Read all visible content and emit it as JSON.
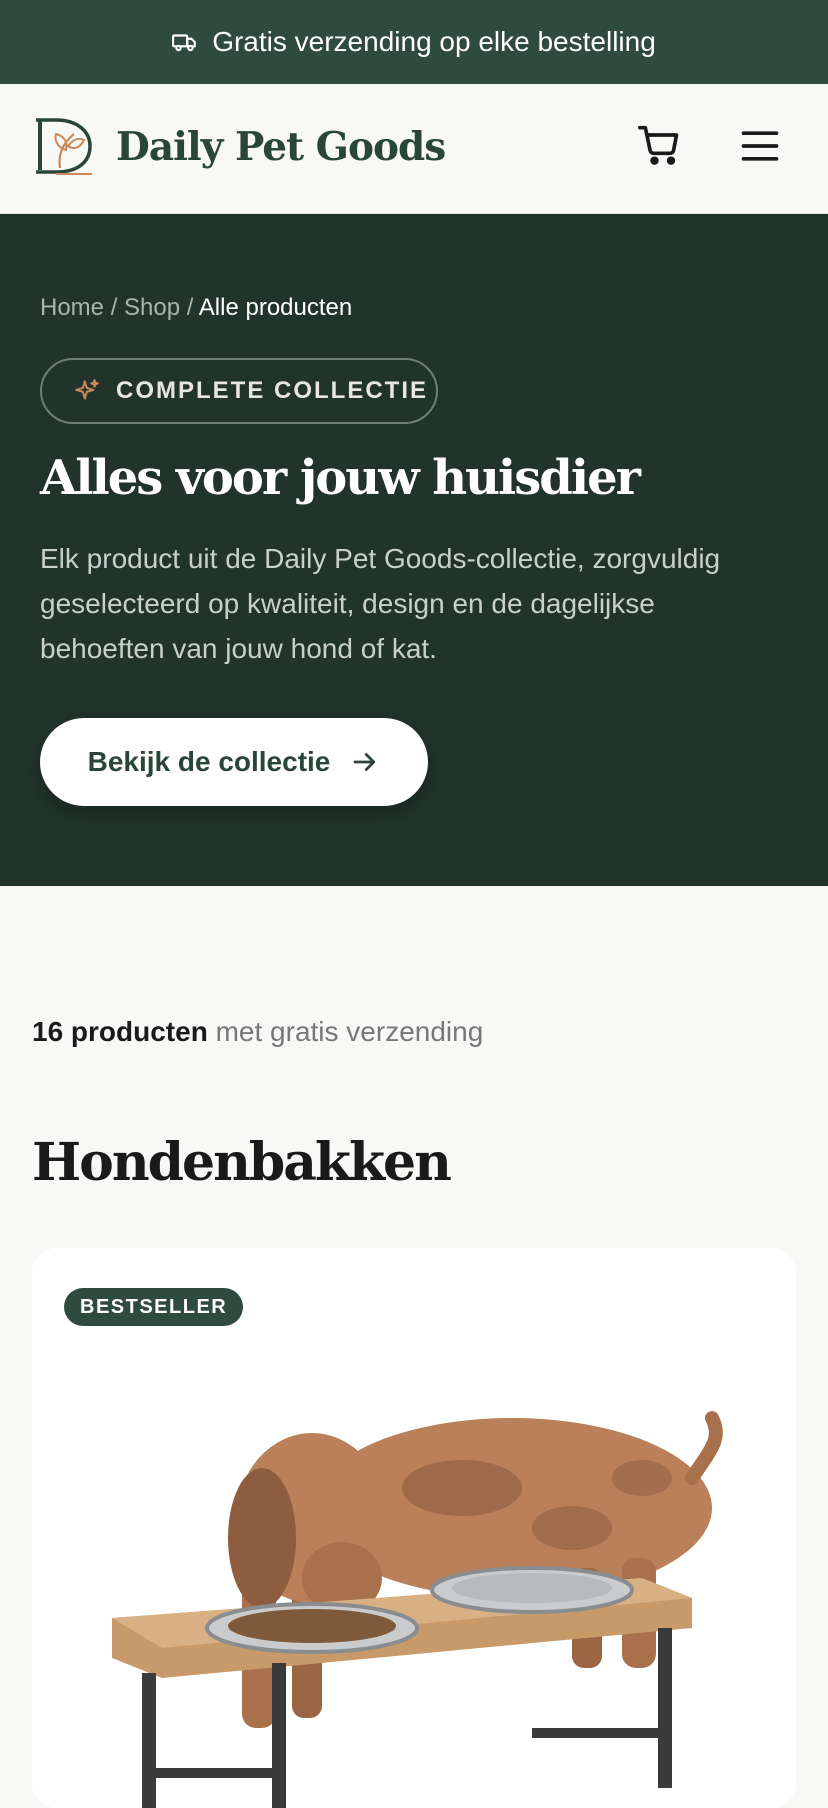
{
  "promo": {
    "text": "Gratis verzending op elke bestelling",
    "icon": "truck-icon"
  },
  "header": {
    "brand": "Daily Pet Goods",
    "logo_icon": "leaf-logo-icon",
    "cart_icon": "cart-icon",
    "menu_icon": "menu-icon"
  },
  "hero": {
    "breadcrumb": {
      "home": "Home",
      "sep1": " / ",
      "shop": "Shop",
      "sep2": " / ",
      "current": "Alle producten"
    },
    "pill": "COMPLETE COLLECTIE",
    "pill_icon": "sparkle-icon",
    "title": "Alles voor jouw huisdier",
    "description": "Elk product uit de Daily Pet Goods-collectie, zorgvuldig geselecteerd op kwaliteit, design en de dagelijkse behoeften van jouw hond of kat.",
    "cta": "Bekijk de collectie",
    "cta_icon": "arrow-right-icon"
  },
  "listing": {
    "count_bold": "16 producten",
    "count_rest": " met gratis verzending",
    "section_title": "Hondenbakken"
  },
  "products": [
    {
      "badge": "BESTSELLER"
    }
  ],
  "colors": {
    "promo_bg": "#2f4a3e",
    "hero_bg": "#21332b",
    "brand": "#2a4638",
    "accent": "#c98a5a",
    "page_bg": "#f8f8f6"
  }
}
